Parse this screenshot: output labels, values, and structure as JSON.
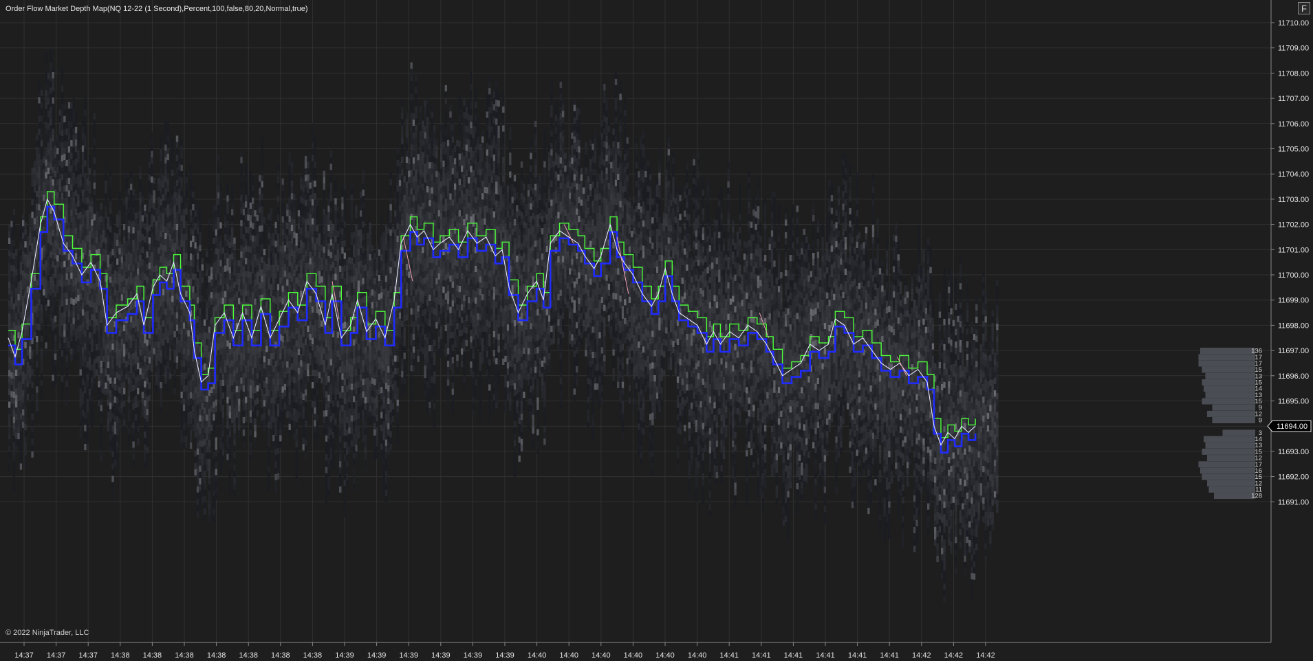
{
  "title": "Order Flow Market Depth Map(NQ 12-22 (1 Second),Percent,100,false,80,20,Normal,true)",
  "copyright": "© 2022 NinjaTrader, LLC",
  "corner_button": "F",
  "colors": {
    "background": "#1e1e1e",
    "ask_line": "#4cff3a",
    "bid_line": "#1f2bff",
    "last_line": "#e6e6ff",
    "last_up": "#f0a0b0",
    "grid": "#303030",
    "text": "#e6e6e6"
  },
  "chart_data": {
    "type": "heatmap",
    "y_axis": {
      "ticks": [
        "11710.00",
        "11709.00",
        "11708.00",
        "11707.00",
        "11706.00",
        "11705.00",
        "11704.00",
        "11703.00",
        "11702.00",
        "11701.00",
        "11700.00",
        "11699.00",
        "11698.00",
        "11697.00",
        "11696.00",
        "11695.00",
        "11694.00",
        "11693.00",
        "11692.00",
        "11691.00"
      ],
      "range": [
        11690.4,
        11710.7
      ],
      "current_price": "11694.00"
    },
    "x_axis": {
      "ticks": [
        "14:37",
        "14:37",
        "14:37",
        "14:38",
        "14:38",
        "14:38",
        "14:38",
        "14:38",
        "14:38",
        "14:38",
        "14:39",
        "14:39",
        "14:39",
        "14:39",
        "14:39",
        "14:39",
        "14:40",
        "14:40",
        "14:40",
        "14:40",
        "14:40",
        "14:40",
        "14:41",
        "14:41",
        "14:41",
        "14:41",
        "14:41",
        "14:41",
        "14:42",
        "14:42",
        "14:42"
      ]
    },
    "ask_sizes": [
      {
        "price": 11697.0,
        "size": "136"
      },
      {
        "price": 11696.75,
        "size": "17"
      },
      {
        "price": 11696.5,
        "size": "17"
      },
      {
        "price": 11696.25,
        "size": "15"
      },
      {
        "price": 11696.0,
        "size": "13"
      },
      {
        "price": 11695.75,
        "size": "15"
      },
      {
        "price": 11695.5,
        "size": "14"
      },
      {
        "price": 11695.25,
        "size": "13"
      },
      {
        "price": 11695.0,
        "size": "15"
      },
      {
        "price": 11694.75,
        "size": "9"
      },
      {
        "price": 11694.5,
        "size": "12"
      },
      {
        "price": 11694.25,
        "size": "9"
      }
    ],
    "bid_sizes": [
      {
        "price": 11693.75,
        "size": "3"
      },
      {
        "price": 11693.5,
        "size": "14"
      },
      {
        "price": 11693.25,
        "size": "13"
      },
      {
        "price": 11693.0,
        "size": "15"
      },
      {
        "price": 11692.75,
        "size": "12"
      },
      {
        "price": 11692.5,
        "size": "17"
      },
      {
        "price": 11692.25,
        "size": "16"
      },
      {
        "price": 11692.0,
        "size": "15"
      },
      {
        "price": 11691.75,
        "size": "12"
      },
      {
        "price": 11691.5,
        "size": "11"
      },
      {
        "price": 11691.25,
        "size": "128"
      }
    ],
    "last_price_series": [
      {
        "t": 0,
        "p": 11697.5
      },
      {
        "t": 3,
        "p": 11696.75
      },
      {
        "t": 6,
        "p": 11697.75
      },
      {
        "t": 10,
        "p": 11699.75
      },
      {
        "t": 14,
        "p": 11702.0
      },
      {
        "t": 17,
        "p": 11703.0
      },
      {
        "t": 20,
        "p": 11702.5
      },
      {
        "t": 24,
        "p": 11701.25
      },
      {
        "t": 28,
        "p": 11700.75
      },
      {
        "t": 32,
        "p": 11700.0
      },
      {
        "t": 36,
        "p": 11700.5
      },
      {
        "t": 40,
        "p": 11699.75
      },
      {
        "t": 43,
        "p": 11698.0
      },
      {
        "t": 47,
        "p": 11698.5
      },
      {
        "t": 52,
        "p": 11698.75
      },
      {
        "t": 56,
        "p": 11699.25
      },
      {
        "t": 59,
        "p": 11698.0
      },
      {
        "t": 63,
        "p": 11699.5
      },
      {
        "t": 66,
        "p": 11700.0
      },
      {
        "t": 69,
        "p": 11699.75
      },
      {
        "t": 72,
        "p": 11700.5
      },
      {
        "t": 75,
        "p": 11699.25
      },
      {
        "t": 79,
        "p": 11698.5
      },
      {
        "t": 81,
        "p": 11697.0
      },
      {
        "t": 84,
        "p": 11695.75
      },
      {
        "t": 87,
        "p": 11696.0
      },
      {
        "t": 90,
        "p": 11698.0
      },
      {
        "t": 94,
        "p": 11698.5
      },
      {
        "t": 98,
        "p": 11697.5
      },
      {
        "t": 102,
        "p": 11698.5
      },
      {
        "t": 106,
        "p": 11697.5
      },
      {
        "t": 110,
        "p": 11698.75
      },
      {
        "t": 114,
        "p": 11697.5
      },
      {
        "t": 118,
        "p": 11698.25
      },
      {
        "t": 122,
        "p": 11699.0
      },
      {
        "t": 126,
        "p": 11698.5
      },
      {
        "t": 130,
        "p": 11699.75
      },
      {
        "t": 134,
        "p": 11699.25
      },
      {
        "t": 138,
        "p": 11698.0
      },
      {
        "t": 141,
        "p": 11699.25
      },
      {
        "t": 145,
        "p": 11697.5
      },
      {
        "t": 149,
        "p": 11698.0
      },
      {
        "t": 152,
        "p": 11699.0
      },
      {
        "t": 156,
        "p": 11697.75
      },
      {
        "t": 160,
        "p": 11698.25
      },
      {
        "t": 164,
        "p": 11697.5
      },
      {
        "t": 168,
        "p": 11699.0
      },
      {
        "t": 171,
        "p": 11701.25
      },
      {
        "t": 175,
        "p": 11702.0
      },
      {
        "t": 178,
        "p": 11701.5
      },
      {
        "t": 181,
        "p": 11701.75
      },
      {
        "t": 185,
        "p": 11701.0
      },
      {
        "t": 188,
        "p": 11701.25
      },
      {
        "t": 192,
        "p": 11701.5
      },
      {
        "t": 196,
        "p": 11701.0
      },
      {
        "t": 200,
        "p": 11701.75
      },
      {
        "t": 204,
        "p": 11701.25
      },
      {
        "t": 208,
        "p": 11701.5
      },
      {
        "t": 212,
        "p": 11700.75
      },
      {
        "t": 215,
        "p": 11701.0
      },
      {
        "t": 218,
        "p": 11699.5
      },
      {
        "t": 222,
        "p": 11698.5
      },
      {
        "t": 226,
        "p": 11699.25
      },
      {
        "t": 230,
        "p": 11699.75
      },
      {
        "t": 233,
        "p": 11699.0
      },
      {
        "t": 236,
        "p": 11701.25
      },
      {
        "t": 240,
        "p": 11701.75
      },
      {
        "t": 244,
        "p": 11701.5
      },
      {
        "t": 248,
        "p": 11701.25
      },
      {
        "t": 251,
        "p": 11700.75
      },
      {
        "t": 255,
        "p": 11700.25
      },
      {
        "t": 258,
        "p": 11700.75
      },
      {
        "t": 262,
        "p": 11702.0
      },
      {
        "t": 265,
        "p": 11701.0
      },
      {
        "t": 268,
        "p": 11700.5
      },
      {
        "t": 272,
        "p": 11700.0
      },
      {
        "t": 276,
        "p": 11699.25
      },
      {
        "t": 280,
        "p": 11698.75
      },
      {
        "t": 283,
        "p": 11699.25
      },
      {
        "t": 286,
        "p": 11700.25
      },
      {
        "t": 289,
        "p": 11699.25
      },
      {
        "t": 292,
        "p": 11698.5
      },
      {
        "t": 296,
        "p": 11698.25
      },
      {
        "t": 300,
        "p": 11698.0
      },
      {
        "t": 304,
        "p": 11697.25
      },
      {
        "t": 307,
        "p": 11697.75
      },
      {
        "t": 310,
        "p": 11697.25
      },
      {
        "t": 314,
        "p": 11697.75
      },
      {
        "t": 318,
        "p": 11697.5
      },
      {
        "t": 322,
        "p": 11698.0
      },
      {
        "t": 326,
        "p": 11697.75
      },
      {
        "t": 330,
        "p": 11697.25
      },
      {
        "t": 333,
        "p": 11696.75
      },
      {
        "t": 337,
        "p": 11696.0
      },
      {
        "t": 341,
        "p": 11696.25
      },
      {
        "t": 345,
        "p": 11696.5
      },
      {
        "t": 349,
        "p": 11697.25
      },
      {
        "t": 353,
        "p": 11697.0
      },
      {
        "t": 357,
        "p": 11697.25
      },
      {
        "t": 360,
        "p": 11698.25
      },
      {
        "t": 364,
        "p": 11698.0
      },
      {
        "t": 368,
        "p": 11697.25
      },
      {
        "t": 372,
        "p": 11697.5
      },
      {
        "t": 376,
        "p": 11697.0
      },
      {
        "t": 380,
        "p": 11696.5
      },
      {
        "t": 384,
        "p": 11696.25
      },
      {
        "t": 388,
        "p": 11696.5
      },
      {
        "t": 392,
        "p": 11696.0
      },
      {
        "t": 396,
        "p": 11696.25
      },
      {
        "t": 400,
        "p": 11695.75
      },
      {
        "t": 403,
        "p": 11694.0
      },
      {
        "t": 406,
        "p": 11693.25
      },
      {
        "t": 409,
        "p": 11693.75
      },
      {
        "t": 412,
        "p": 11693.5
      },
      {
        "t": 415,
        "p": 11694.0
      },
      {
        "t": 418,
        "p": 11693.75
      },
      {
        "t": 421,
        "p": 11694.0
      }
    ],
    "last_up_series": [
      {
        "t": 172,
        "p": 11701.5
      },
      {
        "t": 176,
        "p": 11699.75
      },
      {
        "t": 141,
        "p": 11699.75
      },
      {
        "t": 144,
        "p": 11698.25
      },
      {
        "t": 242,
        "p": 11702.0
      },
      {
        "t": 246,
        "p": 11701.25
      },
      {
        "t": 265,
        "p": 11701.5
      },
      {
        "t": 270,
        "p": 11699.25
      },
      {
        "t": 327,
        "p": 11698.5
      },
      {
        "t": 331,
        "p": 11697.5
      },
      {
        "t": 387,
        "p": 11696.75
      },
      {
        "t": 391,
        "p": 11696.0
      }
    ]
  }
}
